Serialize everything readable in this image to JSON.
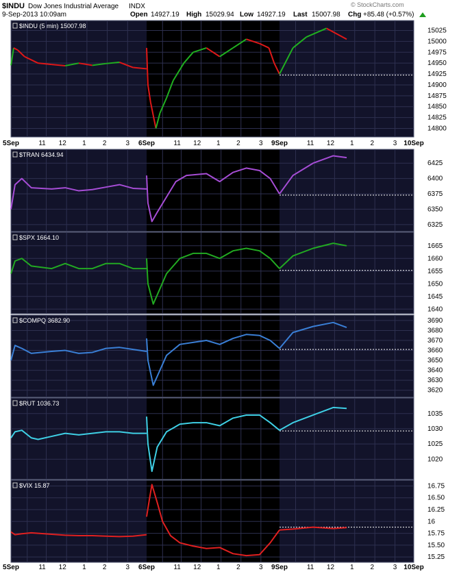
{
  "header": {
    "symbol": "$INDU",
    "name": "Dow Jones Industrial Average",
    "exchange": "INDX",
    "date_time": "9-Sep-2013 10:09am",
    "open_label": "Open",
    "open": "14927.19",
    "high_label": "High",
    "high": "15029.94",
    "low_label": "Low",
    "low": "14927.19",
    "last_label": "Last",
    "last": "15007.98",
    "chg_label": "Chg",
    "chg": "+85.48 (+0.57%)",
    "watermark": "© StockCharts.com"
  },
  "colors": {
    "panel_bg": "#12132a",
    "panel_bg_dark": "#000000",
    "grid": "#2e3050",
    "axis_text": "#000000",
    "ref_line": "#ffffff",
    "up_arrow": "#1e9e1e"
  },
  "chart_data": [
    {
      "type": "line",
      "label": "$INDU (5 min)",
      "last_value": "15007.98",
      "color": "green-red",
      "ylim": [
        14785,
        15040
      ],
      "yticks": [
        14800,
        14825,
        14850,
        14875,
        14900,
        14925,
        14950,
        14975,
        15000,
        15025
      ],
      "reference_line": 14922.5,
      "days": [
        {
          "label": "5Sep",
          "points": [
            [
              0,
              14945
            ],
            [
              0.02,
              14985
            ],
            [
              0.05,
              14980
            ],
            [
              0.1,
              14965
            ],
            [
              0.2,
              14950
            ],
            [
              0.3,
              14947
            ],
            [
              0.4,
              14944
            ],
            [
              0.5,
              14950
            ],
            [
              0.6,
              14945
            ],
            [
              0.7,
              14949
            ],
            [
              0.8,
              14952
            ],
            [
              0.9,
              14940
            ],
            [
              1,
              14937
            ]
          ]
        },
        {
          "label": "6Sep",
          "points": [
            [
              0,
              14985
            ],
            [
              0.01,
              14900
            ],
            [
              0.03,
              14860
            ],
            [
              0.05,
              14830
            ],
            [
              0.07,
              14800
            ],
            [
              0.1,
              14835
            ],
            [
              0.15,
              14870
            ],
            [
              0.2,
              14910
            ],
            [
              0.28,
              14950
            ],
            [
              0.35,
              14975
            ],
            [
              0.45,
              14985
            ],
            [
              0.55,
              14965
            ],
            [
              0.65,
              14985
            ],
            [
              0.75,
              15005
            ],
            [
              0.85,
              14995
            ],
            [
              0.92,
              14985
            ],
            [
              0.96,
              14950
            ],
            [
              1,
              14925
            ]
          ]
        },
        {
          "label": "9Sep",
          "points": [
            [
              0,
              14925
            ],
            [
              0.1,
              14985
            ],
            [
              0.2,
              15010
            ],
            [
              0.35,
              15030
            ],
            [
              0.5,
              15005
            ]
          ]
        }
      ]
    },
    {
      "type": "line",
      "label": "$TRAN",
      "last_value": "6434.94",
      "color": "#a64dd6",
      "ylim": [
        6317,
        6442
      ],
      "yticks": [
        6325,
        6350,
        6375,
        6400,
        6425
      ],
      "reference_line": 6373,
      "days": [
        {
          "points": [
            [
              0,
              6350
            ],
            [
              0.03,
              6390
            ],
            [
              0.08,
              6400
            ],
            [
              0.15,
              6385
            ],
            [
              0.3,
              6383
            ],
            [
              0.4,
              6385
            ],
            [
              0.5,
              6380
            ],
            [
              0.6,
              6382
            ],
            [
              0.7,
              6386
            ],
            [
              0.8,
              6390
            ],
            [
              0.9,
              6384
            ],
            [
              1,
              6383
            ]
          ]
        },
        {
          "points": [
            [
              0,
              6405
            ],
            [
              0.01,
              6360
            ],
            [
              0.04,
              6330
            ],
            [
              0.08,
              6345
            ],
            [
              0.15,
              6370
            ],
            [
              0.22,
              6395
            ],
            [
              0.3,
              6405
            ],
            [
              0.45,
              6408
            ],
            [
              0.55,
              6395
            ],
            [
              0.65,
              6410
            ],
            [
              0.75,
              6417
            ],
            [
              0.85,
              6413
            ],
            [
              0.93,
              6400
            ],
            [
              1,
              6375
            ]
          ]
        },
        {
          "points": [
            [
              0,
              6375
            ],
            [
              0.1,
              6405
            ],
            [
              0.25,
              6425
            ],
            [
              0.4,
              6437
            ],
            [
              0.5,
              6434
            ]
          ]
        }
      ]
    },
    {
      "type": "line",
      "label": "$SPX",
      "last_value": "1664.10",
      "color": "#22aa22",
      "ylim": [
        1639,
        1669
      ],
      "yticks": [
        1640,
        1645,
        1650,
        1655,
        1660,
        1665
      ],
      "reference_line": 1655.3,
      "days": [
        {
          "points": [
            [
              0,
              1654
            ],
            [
              0.03,
              1659
            ],
            [
              0.08,
              1660
            ],
            [
              0.15,
              1657
            ],
            [
              0.3,
              1656
            ],
            [
              0.4,
              1658
            ],
            [
              0.5,
              1656
            ],
            [
              0.6,
              1656
            ],
            [
              0.7,
              1658
            ],
            [
              0.8,
              1658
            ],
            [
              0.9,
              1656
            ],
            [
              1,
              1656
            ]
          ]
        },
        {
          "points": [
            [
              0,
              1660
            ],
            [
              0.01,
              1650
            ],
            [
              0.05,
              1642
            ],
            [
              0.1,
              1648
            ],
            [
              0.15,
              1654
            ],
            [
              0.25,
              1660
            ],
            [
              0.35,
              1662
            ],
            [
              0.45,
              1662
            ],
            [
              0.55,
              1660
            ],
            [
              0.65,
              1663
            ],
            [
              0.75,
              1664
            ],
            [
              0.85,
              1663
            ],
            [
              0.93,
              1660
            ],
            [
              1,
              1656
            ]
          ]
        },
        {
          "points": [
            [
              0,
              1656
            ],
            [
              0.1,
              1661
            ],
            [
              0.25,
              1664
            ],
            [
              0.4,
              1666
            ],
            [
              0.5,
              1665
            ]
          ]
        }
      ]
    },
    {
      "type": "line",
      "label": "$COMPQ",
      "last_value": "3682.90",
      "color": "#3a7fd6",
      "ylim": [
        3615,
        3692
      ],
      "yticks": [
        3620,
        3630,
        3640,
        3650,
        3660,
        3670,
        3680,
        3690
      ],
      "reference_line": 3661,
      "days": [
        {
          "points": [
            [
              0,
              3650
            ],
            [
              0.03,
              3665
            ],
            [
              0.08,
              3662
            ],
            [
              0.15,
              3657
            ],
            [
              0.3,
              3659
            ],
            [
              0.4,
              3660
            ],
            [
              0.5,
              3657
            ],
            [
              0.6,
              3658
            ],
            [
              0.7,
              3662
            ],
            [
              0.8,
              3663
            ],
            [
              0.9,
              3661
            ],
            [
              1,
              3659
            ]
          ]
        },
        {
          "points": [
            [
              0,
              3672
            ],
            [
              0.01,
              3650
            ],
            [
              0.05,
              3625
            ],
            [
              0.1,
              3640
            ],
            [
              0.15,
              3655
            ],
            [
              0.25,
              3666
            ],
            [
              0.35,
              3668
            ],
            [
              0.45,
              3670
            ],
            [
              0.55,
              3666
            ],
            [
              0.65,
              3672
            ],
            [
              0.75,
              3676
            ],
            [
              0.85,
              3675
            ],
            [
              0.93,
              3670
            ],
            [
              1,
              3662
            ]
          ]
        },
        {
          "points": [
            [
              0,
              3662
            ],
            [
              0.1,
              3678
            ],
            [
              0.25,
              3684
            ],
            [
              0.4,
              3688
            ],
            [
              0.5,
              3683
            ]
          ]
        }
      ]
    },
    {
      "type": "line",
      "label": "$RUT",
      "last_value": "1036.73",
      "color": "#3fd0e6",
      "ylim": [
        1014,
        1039
      ],
      "yticks": [
        1020,
        1025,
        1030,
        1035
      ],
      "reference_line": 1029.3,
      "days": [
        {
          "points": [
            [
              0,
              1027
            ],
            [
              0.03,
              1029
            ],
            [
              0.08,
              1029.5
            ],
            [
              0.15,
              1027
            ],
            [
              0.2,
              1026.5
            ],
            [
              0.3,
              1027.5
            ],
            [
              0.4,
              1028.5
            ],
            [
              0.5,
              1028
            ],
            [
              0.6,
              1028.5
            ],
            [
              0.7,
              1029
            ],
            [
              0.8,
              1029
            ],
            [
              0.9,
              1028.5
            ],
            [
              1,
              1028.5
            ]
          ]
        },
        {
          "points": [
            [
              0,
              1034
            ],
            [
              0.01,
              1025
            ],
            [
              0.04,
              1016
            ],
            [
              0.08,
              1024
            ],
            [
              0.15,
              1029
            ],
            [
              0.25,
              1031.5
            ],
            [
              0.35,
              1032
            ],
            [
              0.45,
              1032
            ],
            [
              0.55,
              1031
            ],
            [
              0.65,
              1033.5
            ],
            [
              0.75,
              1034.5
            ],
            [
              0.85,
              1034.5
            ],
            [
              0.93,
              1032
            ],
            [
              1,
              1029.5
            ]
          ]
        },
        {
          "points": [
            [
              0,
              1029.5
            ],
            [
              0.1,
              1032
            ],
            [
              0.25,
              1034.5
            ],
            [
              0.4,
              1037
            ],
            [
              0.5,
              1036.7
            ]
          ]
        }
      ]
    },
    {
      "type": "line",
      "label": "$VIX",
      "last_value": "15.87",
      "color": "#e02020",
      "ylim": [
        15.18,
        16.8
      ],
      "yticks": [
        15.25,
        15.5,
        15.75,
        16.0,
        16.25,
        16.5,
        16.75
      ],
      "reference_line": 15.88,
      "days": [
        {
          "points": [
            [
              0,
              15.78
            ],
            [
              0.03,
              15.72
            ],
            [
              0.08,
              15.74
            ],
            [
              0.15,
              15.76
            ],
            [
              0.3,
              15.73
            ],
            [
              0.4,
              15.71
            ],
            [
              0.5,
              15.7
            ],
            [
              0.6,
              15.7
            ],
            [
              0.7,
              15.69
            ],
            [
              0.8,
              15.68
            ],
            [
              0.9,
              15.69
            ],
            [
              1,
              15.72
            ]
          ]
        },
        {
          "points": [
            [
              0,
              16.1
            ],
            [
              0.02,
              16.45
            ],
            [
              0.04,
              16.78
            ],
            [
              0.08,
              16.4
            ],
            [
              0.12,
              16.0
            ],
            [
              0.18,
              15.7
            ],
            [
              0.25,
              15.55
            ],
            [
              0.35,
              15.48
            ],
            [
              0.45,
              15.43
            ],
            [
              0.55,
              15.45
            ],
            [
              0.65,
              15.32
            ],
            [
              0.75,
              15.28
            ],
            [
              0.85,
              15.3
            ],
            [
              0.93,
              15.55
            ],
            [
              1,
              15.82
            ]
          ]
        },
        {
          "points": [
            [
              0,
              15.82
            ],
            [
              0.1,
              15.84
            ],
            [
              0.25,
              15.88
            ],
            [
              0.4,
              15.85
            ],
            [
              0.5,
              15.87
            ]
          ]
        }
      ]
    }
  ],
  "x_axis": {
    "top_labels": [
      "5Sep",
      "11",
      "12",
      "1",
      "2",
      "3",
      "6Sep",
      "11",
      "12",
      "1",
      "2",
      "3",
      "9Sep",
      "11",
      "12",
      "1",
      "2",
      "3",
      "10Sep"
    ],
    "bottom_labels": [
      "5Sep",
      "11",
      "12",
      "1",
      "2",
      "3",
      "6Sep",
      "11",
      "12",
      "1",
      "2",
      "3",
      "9Sep",
      "11",
      "12",
      "1",
      "2",
      "3",
      "10Sep"
    ],
    "major_labels": [
      "5Sep",
      "6Sep",
      "9Sep",
      "10Sep"
    ]
  }
}
